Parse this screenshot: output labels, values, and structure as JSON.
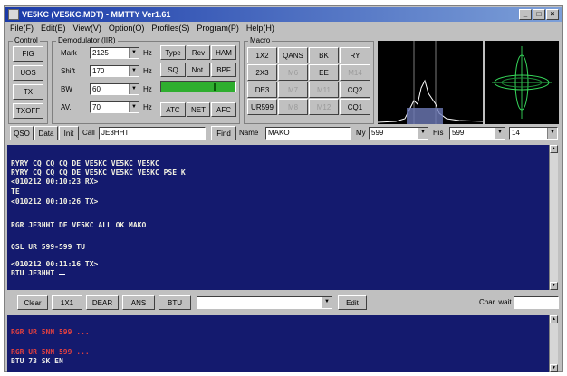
{
  "window": {
    "title": "VE5KC (VE5KC.MDT) - MMTTY Ver1.61"
  },
  "menu": [
    "File(F)",
    "Edit(E)",
    "View(V)",
    "Option(O)",
    "Profiles(S)",
    "Program(P)",
    "Help(H)"
  ],
  "control": {
    "label": "Control",
    "fig": "FIG",
    "uos": "UOS",
    "tx": "TX",
    "txoff": "TXOFF"
  },
  "demod": {
    "label": "Demodulator (IIR)",
    "mark_label": "Mark",
    "mark_value": "2125",
    "mark_unit": "Hz",
    "shift_label": "Shift",
    "shift_value": "170",
    "shift_unit": "Hz",
    "bw_label": "BW",
    "bw_value": "60",
    "bw_unit": "Hz",
    "av_label": "AV.",
    "av_value": "70",
    "av_unit": "Hz",
    "type": "Type",
    "rev": "Rev",
    "ham": "HAM",
    "sq": "SQ",
    "not": "Not.",
    "bpf": "BPF",
    "atc": "ATC",
    "net": "NET",
    "afc": "AFC"
  },
  "macro": {
    "label": "Macro",
    "rows": [
      [
        "1X2",
        "QANS",
        "BK",
        "RY"
      ],
      [
        "2X3",
        "M6",
        "EE",
        "M14"
      ],
      [
        "DE3",
        "M7",
        "M11",
        "CQ2"
      ],
      [
        "UR599",
        "M8",
        "M12",
        "CQ1"
      ]
    ]
  },
  "infobar": {
    "qso": "QSO",
    "data": "Data",
    "init": "Init",
    "call_label": "Call",
    "call_value": "JE3HHT",
    "find": "Find",
    "name_label": "Name",
    "name_value": "MAKO",
    "my_label": "My",
    "my_value": "599",
    "his_label": "His",
    "his_value": "599",
    "band_value": "14"
  },
  "rx_lines": [
    "RYRY CQ CQ CQ DE VE5KC VE5KC VE5KC",
    "RYRY CQ CQ CQ DE VE5KC VE5KC VE5KC PSE K",
    "<010212 00:10:23 RX>",
    "TE",
    "<010212 00:10:26 TX>",
    "",
    "RGR JE3HHT DE VE5KC ALL OK MAKO",
    "",
    "QSL UR 599-599 TU",
    "",
    "<010212 00:11:16 TX>",
    "BTU JE3HHT "
  ],
  "txbar": {
    "clear": "Clear",
    "b1x1": "1X1",
    "dear": "DEAR",
    "ans": "ANS",
    "btu": "BTU",
    "edit": "Edit",
    "charwait": "Char. wait"
  },
  "tx_lines": [
    {
      "text": "RGR UR 5NN 599 ...",
      "cls": "red"
    },
    {
      "text": "",
      "cls": "red"
    },
    {
      "text": "RGR UR 5NN 599 ...",
      "cls": "red"
    },
    {
      "text": "BTU 73 SK EN",
      "cls": "wht"
    }
  ]
}
